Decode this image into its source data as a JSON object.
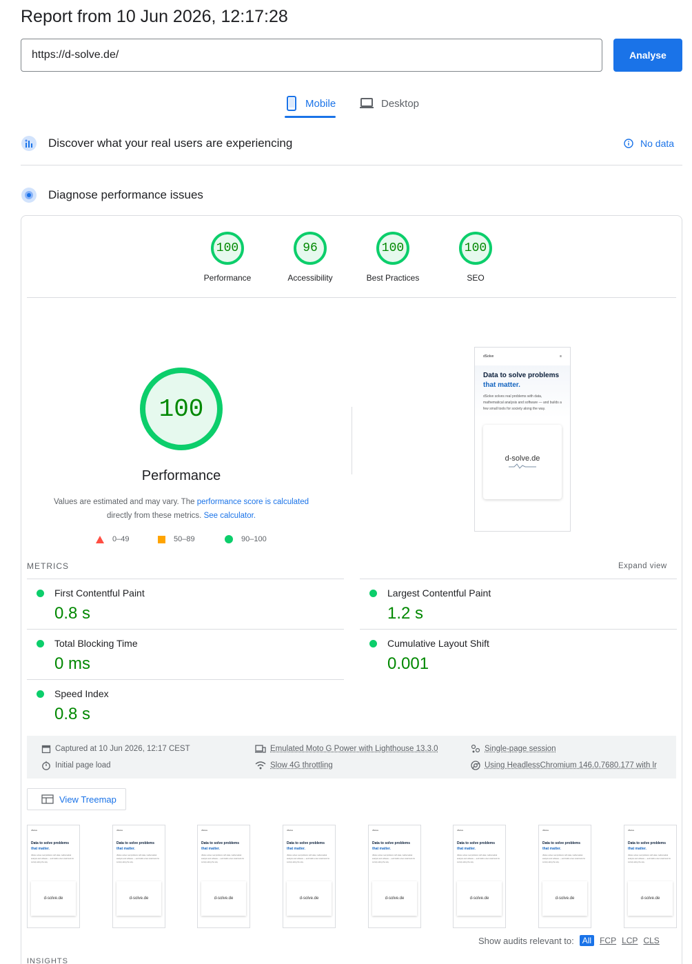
{
  "header": {
    "title": "Report from 10 Jun 2026, 12:17:28",
    "url_value": "https://d-solve.de/",
    "analyse_label": "Analyse"
  },
  "tabs": [
    {
      "label": "Mobile",
      "icon": "phone-icon",
      "active": true
    },
    {
      "label": "Desktop",
      "icon": "laptop-icon",
      "active": false
    }
  ],
  "sections": {
    "field": {
      "title": "Discover what your real users are experiencing",
      "status": "No data",
      "icon": "crux-icon"
    },
    "lab": {
      "title": "Diagnose performance issues",
      "icon": "lighthouse-icon"
    }
  },
  "scores": [
    {
      "label": "Performance",
      "value": "100"
    },
    {
      "label": "Accessibility",
      "value": "96"
    },
    {
      "label": "Best Practices",
      "value": "100"
    },
    {
      "label": "SEO",
      "value": "100"
    }
  ],
  "performance": {
    "score": "100",
    "title": "Performance",
    "desc_before": "Values are estimated and may vary. The ",
    "desc_link1": "performance score is calculated",
    "desc_mid": " directly from these metrics. ",
    "desc_link2": "See calculator."
  },
  "legend": [
    {
      "shape": "triangle",
      "color": "#ff4e42",
      "range": "0–49"
    },
    {
      "shape": "square",
      "color": "#ffa400",
      "range": "50–89"
    },
    {
      "shape": "circle",
      "color": "#0cce6b",
      "range": "90–100"
    }
  ],
  "screenshot": {
    "brand": "dSolve",
    "heading_a": "Data to solve problems ",
    "heading_b": "that matter.",
    "body": "dSolve solves real problems with data, mathematical analysis and software — and builds a few small tools for society along the way.",
    "logo": "d-solve.de"
  },
  "metrics": {
    "label": "METRICS",
    "expand": "Expand view",
    "items": [
      {
        "name": "First Contentful Paint",
        "value": "0.8 s"
      },
      {
        "name": "Largest Contentful Paint",
        "value": "1.2 s"
      },
      {
        "name": "Total Blocking Time",
        "value": "0 ms"
      },
      {
        "name": "Cumulative Layout Shift",
        "value": "0.001"
      },
      {
        "name": "Speed Index",
        "value": "0.8 s"
      }
    ]
  },
  "environment": [
    {
      "icon": "calendar-icon",
      "text": "Captured at 10 Jun 2026, 12:17 CEST"
    },
    {
      "icon": "stopwatch-icon",
      "text": "Initial page load"
    },
    {
      "icon": "devices-icon",
      "text": "Emulated Moto G Power with Lighthouse 13.3.0"
    },
    {
      "icon": "wifi-icon",
      "text": "Slow 4G throttling"
    },
    {
      "icon": "session-icon",
      "text": "Single-page session"
    },
    {
      "icon": "chrome-icon",
      "text": "Using HeadlessChromium 146.0.7680.177 with lr"
    }
  ],
  "treemap_label": "View Treemap",
  "filmstrip_count": 8,
  "audits_filter": {
    "label": "Show audits relevant to:",
    "options": [
      "All",
      "FCP",
      "LCP",
      "CLS"
    ],
    "selected": "All"
  },
  "insights_label": "INSIGHTS"
}
